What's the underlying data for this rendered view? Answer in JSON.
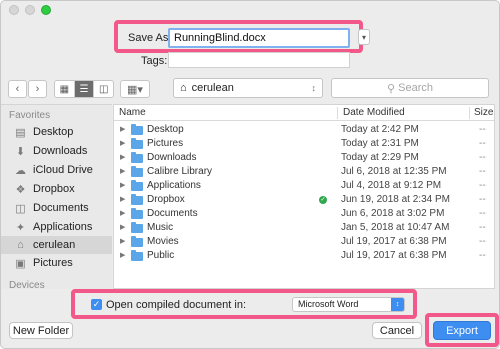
{
  "save_as": {
    "label": "Save As:",
    "value": "RunningBlind.docx"
  },
  "tags": {
    "label": "Tags:",
    "value": ""
  },
  "toolbar": {
    "back_icon": "chevron-left-icon",
    "forward_icon": "chevron-right-icon",
    "location": "cerulean",
    "search_placeholder": "Search"
  },
  "sidebar": {
    "favorites_heading": "Favorites",
    "devices_heading": "Devices",
    "items": [
      {
        "label": "Desktop",
        "icon": "desktop-icon"
      },
      {
        "label": "Downloads",
        "icon": "downloads-icon"
      },
      {
        "label": "iCloud Drive",
        "icon": "cloud-icon"
      },
      {
        "label": "Dropbox",
        "icon": "dropbox-icon"
      },
      {
        "label": "Documents",
        "icon": "documents-icon"
      },
      {
        "label": "Applications",
        "icon": "applications-icon"
      },
      {
        "label": "cerulean",
        "icon": "home-icon",
        "selected": true
      },
      {
        "label": "Pictures",
        "icon": "pictures-icon"
      }
    ]
  },
  "file_list": {
    "columns": {
      "name": "Name",
      "date": "Date Modified",
      "size": "Size"
    },
    "rows": [
      {
        "name": "Desktop",
        "date": "Today at 2:42 PM"
      },
      {
        "name": "Pictures",
        "date": "Today at 2:31 PM"
      },
      {
        "name": "Downloads",
        "date": "Today at 2:29 PM"
      },
      {
        "name": "Calibre Library",
        "date": "Jul 6, 2018 at 12:35 PM"
      },
      {
        "name": "Applications",
        "date": "Jul 4, 2018 at 9:12 PM"
      },
      {
        "name": "Dropbox",
        "date": "Jun 19, 2018 at 2:34 PM",
        "synced": true
      },
      {
        "name": "Documents",
        "date": "Jun 6, 2018 at 3:02 PM"
      },
      {
        "name": "Music",
        "date": "Jan 5, 2018 at 10:47 AM"
      },
      {
        "name": "Movies",
        "date": "Jul 19, 2017 at 6:38 PM"
      },
      {
        "name": "Public",
        "date": "Jul 19, 2017 at 6:38 PM"
      }
    ]
  },
  "options": {
    "open_compiled_label": "Open compiled document in:",
    "open_compiled_checked": true,
    "app_selected": "Microsoft Word"
  },
  "buttons": {
    "new_folder": "New Folder",
    "cancel": "Cancel",
    "export": "Export"
  },
  "colors": {
    "highlight": "#f2588a",
    "accent": "#3d8ef0",
    "folder": "#5aa6e8"
  }
}
